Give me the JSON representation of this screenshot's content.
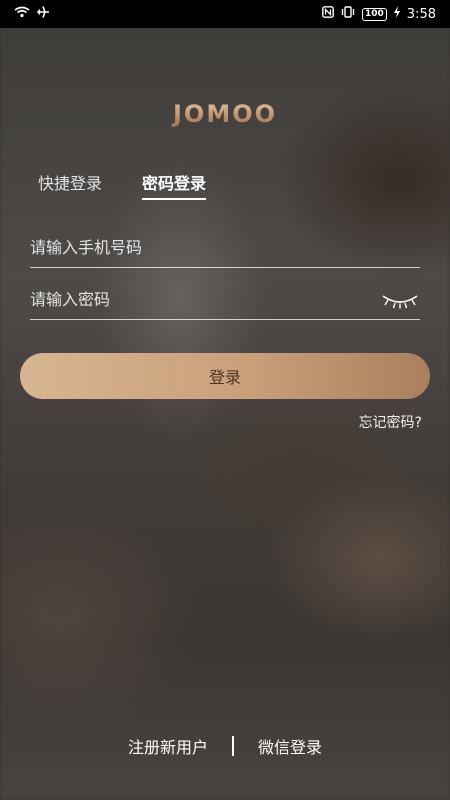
{
  "status": {
    "time": "3:58",
    "battery": "100"
  },
  "brand": {
    "logo_text": "JOMOO"
  },
  "tabs": [
    {
      "label": "快捷登录",
      "active": false
    },
    {
      "label": "密码登录",
      "active": true
    }
  ],
  "form": {
    "phone_placeholder": "请输入手机号码",
    "password_placeholder": "请输入密码",
    "login_label": "登录",
    "forgot_label": "忘记密码?"
  },
  "footer": {
    "register_label": "注册新用户",
    "wechat_label": "微信登录"
  },
  "colors": {
    "accent": "#c9a07a",
    "logo": "#c39670"
  }
}
